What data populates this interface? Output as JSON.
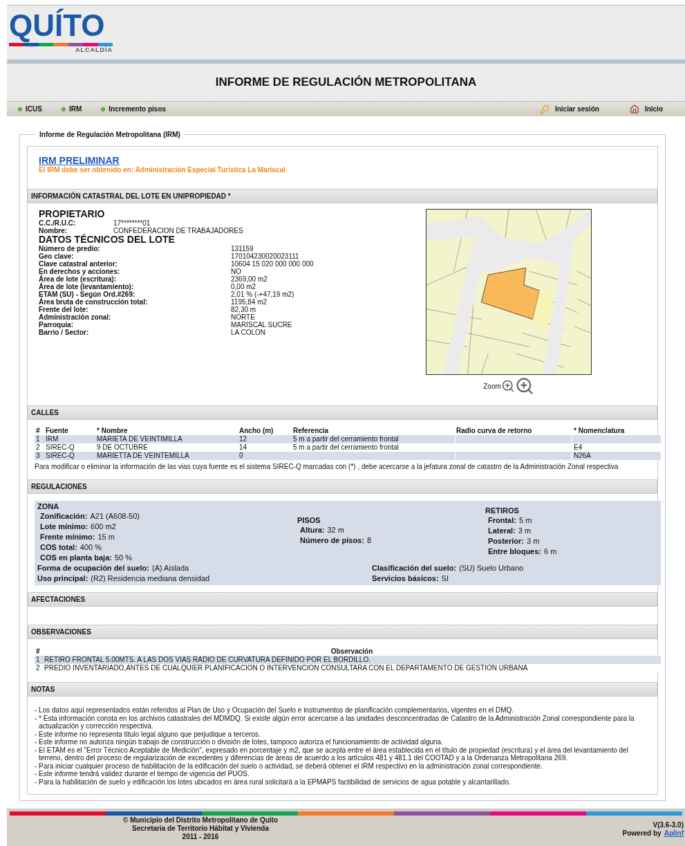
{
  "header": {
    "logo_text": "QUÍTO",
    "logo_subtitle": "ALCALDÍA",
    "title": "INFORME DE REGULACIÓN METROPOLITANA"
  },
  "nav": {
    "items": [
      {
        "label": "ICUS"
      },
      {
        "label": "IRM"
      },
      {
        "label": "Incremento pisos"
      }
    ],
    "login": "Iniciar sesión",
    "home": "Inicio"
  },
  "legend": "Informe de Regulación Metropolitana (IRM)",
  "preliminary": {
    "link": "IRM PRELIMINAR",
    "note": "El IRM debe ser obtenido en: Administración Especial Turística La Mariscal"
  },
  "catastral": {
    "title": "INFORMACIÓN CATASTRAL DEL LOTE EN UNIPROPIEDAD *",
    "owner_heading": "PROPIETARIO",
    "owner": [
      {
        "label": "C.C./R.U.C:",
        "value": "17********01"
      },
      {
        "label": "Nombre:",
        "value": "CONFEDERACION DE TRABAJADORES"
      }
    ],
    "tech_heading": "DATOS TÉCNICOS DEL LOTE",
    "tech": [
      {
        "label": "Número de predio:",
        "value": "131159"
      },
      {
        "label": "Geo clave:",
        "value": "170104230020023111"
      },
      {
        "label": "Clave catastral anterior:",
        "value": "10604 15 020 000 000 000"
      },
      {
        "label": "En derechos y acciones:",
        "value": "NO"
      },
      {
        "label": "Área de lote (escritura):",
        "value": "2369,00 m2"
      },
      {
        "label": "Área de lote (levantamiento):",
        "value": "0,00 m2"
      },
      {
        "label": "ETAM (SU) - Según Ord.#269:",
        "value": "2,01 % (-+47,19 m2)"
      },
      {
        "label": "Área bruta de construcción total:",
        "value": "1195,84 m2"
      },
      {
        "label": "Frente del lote:",
        "value": "82,30 m"
      },
      {
        "label": "Administración zonal:",
        "value": "NORTE"
      },
      {
        "label": "Parroquia:",
        "value": "MARISCAL SUCRE"
      },
      {
        "label": "Barrio / Sector:",
        "value": "LA COLON"
      }
    ],
    "map": {
      "kind": "picture",
      "zoom_label": "Zoom"
    }
  },
  "calles": {
    "title": "CALLES",
    "columns": [
      "#",
      "Fuente",
      "* Nombre",
      "Ancho (m)",
      "Referencia",
      "Radio curva de retorno",
      "* Nomenclatura"
    ],
    "rows": [
      [
        "1",
        "IRM",
        "MARIETA DE VEINTIMILLA",
        "12",
        "5 m a partir del cerramiento frontal",
        "",
        ""
      ],
      [
        "2",
        "SIREC-Q",
        "9 DE OCTUBRE",
        "14",
        "5 m a partir del cerramiento frontal",
        "",
        "E4"
      ],
      [
        "3",
        "SIREC-Q",
        "MARIETTA DE VEINTEMILLA",
        "0",
        "",
        "",
        "N26A"
      ]
    ],
    "note": "Para modificar o eliminar la información de las vias cuya fuente es el sistema SIREC-Q marcadas con (*) , debe acercarse a la jefatura zonal de catastro de la Administración Zonal respectiva"
  },
  "regulaciones": {
    "title": "REGULACIONES",
    "zona": {
      "heading": "ZONA",
      "items": [
        {
          "label": "Zonificación:",
          "value": "A21 (A608-50)"
        },
        {
          "label": "Lote mínimo:",
          "value": "600 m2"
        },
        {
          "label": "Frente mínimo:",
          "value": "15 m"
        },
        {
          "label": "COS total:",
          "value": "400 %"
        },
        {
          "label": "COS en planta baja:",
          "value": "50 %"
        }
      ]
    },
    "pisos": {
      "heading": "PISOS",
      "items": [
        {
          "label": "Altura:",
          "value": "32 m"
        },
        {
          "label": "Número de pisos:",
          "value": "8"
        }
      ]
    },
    "retiros": {
      "heading": "RETIROS",
      "items": [
        {
          "label": "Frontal:",
          "value": "5 m"
        },
        {
          "label": "Lateral:",
          "value": "3 m"
        },
        {
          "label": "Posterior:",
          "value": "3 m"
        },
        {
          "label": "Entre bloques:",
          "value": "6 m"
        }
      ]
    },
    "bottom_left": [
      {
        "label": "Forma de ocupación del suelo:",
        "value": "(A) Aislada"
      },
      {
        "label": "Uso principal:",
        "value": "(R2) Residencia mediana densidad"
      }
    ],
    "bottom_right": [
      {
        "label": "Clasificación del suelo:",
        "value": "(SU) Suelo Urbano"
      },
      {
        "label": "Servicios básicos:",
        "value": "SI"
      }
    ]
  },
  "afectaciones": {
    "title": "AFECTACIONES"
  },
  "observaciones": {
    "title": "OBSERVACIONES",
    "columns": [
      "#",
      "Observación"
    ],
    "rows": [
      [
        "1",
        "RETIRO FRONTAL 5.00MTS. A LAS DOS VIAS RADIO DE CURVATURA DEFINIDO POR EL BORDILLO."
      ],
      [
        "2",
        "PREDIO INVENTARIADO,ANTES DE CUALQUIER PLANIFICACION O INTERVENCION CONSULTARA CON EL DEPARTAMENTO DE GESTION URBANA"
      ]
    ]
  },
  "notas": {
    "title": "NOTAS",
    "items": [
      "- Los datos aquí representados están referidos al Plan de Uso y Ocupación del Suelo e instrumentos de planificación complementarios, vigentes en el DMQ.",
      "- * Esta información consta en los archivos catastrales del MDMDQ. Si existe algún error acercarse a las unidades desconcentradas de Catastro de la Administración Zonal correspondiente para la actualización y corrección respectiva.",
      "- Este informe no representa título legal alguno que perjudique a terceros.",
      "- Este informe no autoriza ningún trabajo de construcción o división de lotes, tampoco autoriza el funcionamiento de actividad alguna.",
      "- El ETAM es el \"Error Técnico Aceptable de Medición\", expresado en porcentaje y m2, que se acepta entre el área establecida en el título de propiedad (escritura) y el área del levantamiento del terreno, dentro del proceso de regularización de excedentes y diferencias de áreas de acuerdo a los artículos 481 y 481.1 del COOTAD y a la Ordenanza Metropolitana 269.",
      "- Para iniciar cualquier proceso de habilitación de la edificación del suelo o actividad, se deberá obtener el IRM respectivo en la administración zonal correspondiente.",
      "- Este informe tendrá validez durante el tiempo de vigencia del PUOS.",
      "- Para la habilitación de suelo y edificación los lotes ubicados en área rural solicitará a la EPMAPS factibilidad de servicios de agua potable y alcantarillado."
    ]
  },
  "footer": {
    "lines": [
      "© Municipio del Distrito Metropolitano de Quito",
      "Secretaría de Territorio Hábitat y Vivienda",
      "2011 - 2016"
    ],
    "version": "V(3.6-3.0)",
    "powered_by": "Powered by",
    "powered_link": "Aplinf"
  }
}
